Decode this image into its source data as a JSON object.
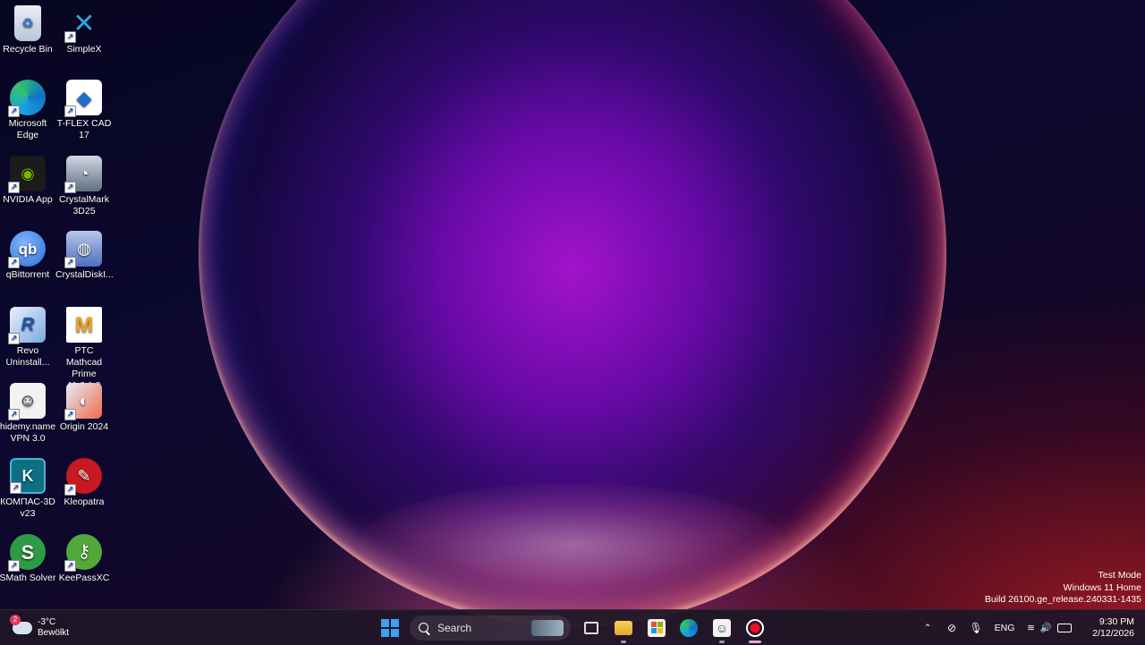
{
  "desktop": {
    "icons": [
      {
        "label": "Recycle Bin",
        "icon": "recycle-bin-icon"
      },
      {
        "label": "SimpleX",
        "icon": "simplex-icon"
      },
      {
        "label": "Microsoft Edge",
        "icon": "edge-icon"
      },
      {
        "label": "T-FLEX CAD 17",
        "icon": "tflex-icon"
      },
      {
        "label": "NVIDIA App",
        "icon": "nvidia-icon"
      },
      {
        "label": "CrystalMark 3D25",
        "icon": "crystalmark-icon"
      },
      {
        "label": "qBittorrent",
        "icon": "qbittorrent-icon"
      },
      {
        "label": "CrystalDiskI...",
        "icon": "crystaldiskinfo-icon"
      },
      {
        "label": "Revo Uninstall...",
        "icon": "revo-icon"
      },
      {
        "label": "PTC Mathcad Prime 11.0.1.0",
        "icon": "mathcad-icon"
      },
      {
        "label": "hidemy.name VPN 3.0",
        "icon": "hidemy-icon"
      },
      {
        "label": "Origin 2024",
        "icon": "origin-icon"
      },
      {
        "label": "КОМПАС-3D v23",
        "icon": "kompas-icon"
      },
      {
        "label": "Kleopatra",
        "icon": "kleopatra-icon"
      },
      {
        "label": "SMath Solver",
        "icon": "smath-icon"
      },
      {
        "label": "KeePassXC",
        "icon": "keepassxc-icon"
      }
    ]
  },
  "watermark": {
    "line1": "Test Mode",
    "line2": "Windows 11 Home",
    "line3": "Build 26100.ge_release.240331-1435"
  },
  "taskbar": {
    "weather": {
      "temp": "-3°C",
      "condition": "Bewölkt",
      "badge": "2"
    },
    "search": {
      "label": "Search"
    },
    "tray": {
      "language": "ENG"
    },
    "clock": {
      "time": "9:30 PM",
      "date": "2/12/2026"
    }
  },
  "colors": {
    "taskbar_bg": "#1e1626",
    "active_indicator": "#e8a6d4",
    "record_red": "#e81123"
  }
}
